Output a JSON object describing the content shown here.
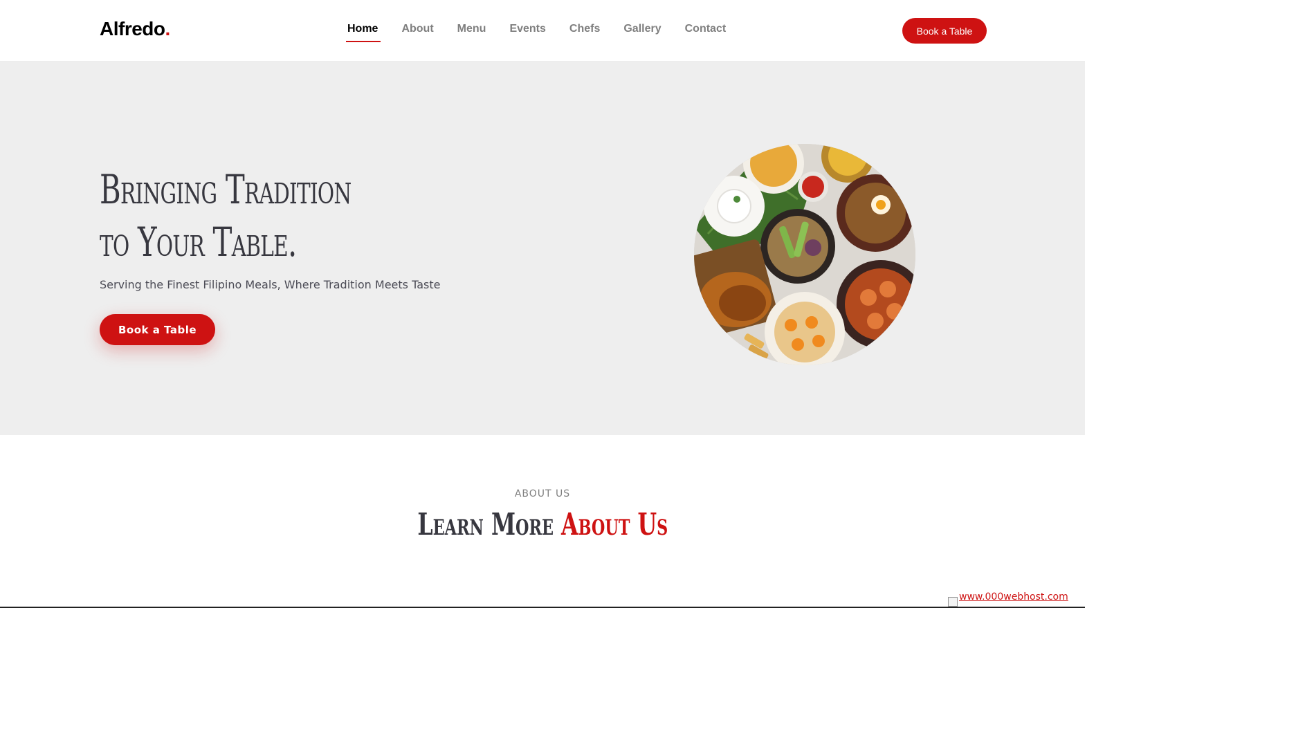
{
  "brand": {
    "name": "Alfredo",
    "dot": "."
  },
  "nav": {
    "items": [
      {
        "label": "Home",
        "active": true
      },
      {
        "label": "About"
      },
      {
        "label": "Menu"
      },
      {
        "label": "Events"
      },
      {
        "label": "Chefs"
      },
      {
        "label": "Gallery"
      },
      {
        "label": "Contact"
      }
    ],
    "cta_label": "Book a Table"
  },
  "hero": {
    "title_line1": "Bringing Tradition",
    "title_line2": "to Your Table.",
    "subtitle": "Serving the Finest Filipino Meals, Where Tradition Meets Taste",
    "cta_label": "Book a Table"
  },
  "about": {
    "label": "ABOUT US",
    "title_plain": "Learn More",
    "title_accent": "About Us"
  },
  "footer": {
    "host_link": "www.000webhost.com"
  },
  "colors": {
    "accent": "#ce1212",
    "hero_bg": "#eeeeee",
    "text_dark": "#37373f"
  }
}
